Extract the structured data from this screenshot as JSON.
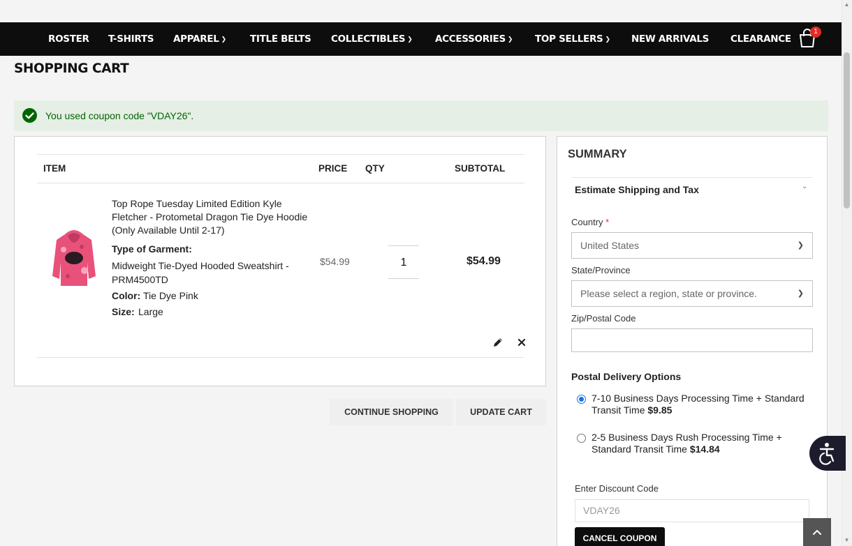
{
  "nav": {
    "items": [
      {
        "label": "ROSTER",
        "dropdown": false
      },
      {
        "label": "T-SHIRTS",
        "dropdown": false
      },
      {
        "label": "APPAREL",
        "dropdown": true
      },
      {
        "label": "TITLE BELTS",
        "dropdown": false
      },
      {
        "label": "COLLECTIBLES",
        "dropdown": true
      },
      {
        "label": "ACCESSORIES",
        "dropdown": true
      },
      {
        "label": "TOP SELLERS",
        "dropdown": true
      },
      {
        "label": "NEW ARRIVALS",
        "dropdown": false
      },
      {
        "label": "CLEARANCE",
        "dropdown": false
      }
    ],
    "cart_count": "1"
  },
  "page": {
    "title": "SHOPPING CART"
  },
  "message": {
    "text": "You used coupon code \"VDAY26\"."
  },
  "cart": {
    "headers": {
      "item": "ITEM",
      "price": "PRICE",
      "qty": "QTY",
      "subtotal": "SUBTOTAL"
    },
    "item": {
      "name": "Top Rope Tuesday Limited Edition Kyle Fletcher - Protometal Dragon Tie Dye Hoodie (Only Available Until 2-17)",
      "garment_label": "Type of Garment:",
      "garment_value": "Midweight Tie-Dyed Hooded Sweatshirt - PRM4500TD",
      "color_label": "Color:",
      "color_value": "Tie Dye Pink",
      "size_label": "Size:",
      "size_value": "Large",
      "price": "$54.99",
      "qty": "1",
      "subtotal": "$54.99"
    },
    "continue_label": "CONTINUE SHOPPING",
    "update_label": "UPDATE CART"
  },
  "summary": {
    "title": "SUMMARY",
    "estimate_title": "Estimate Shipping and Tax",
    "country_label": "Country",
    "country_required_mark": "*",
    "country_value": "United States",
    "state_label": "State/Province",
    "state_placeholder": "Please select a region, state or province.",
    "zip_label": "Zip/Postal Code",
    "zip_value": "",
    "delivery_title": "Postal Delivery Options",
    "options": [
      {
        "text": "7-10 Business Days Processing Time + Standard Transit Time",
        "price": "$9.85",
        "selected": true
      },
      {
        "text": "2-5 Business Days Rush Processing Time + Standard Transit Time",
        "price": "$14.84",
        "selected": false
      }
    ],
    "discount_label": "Enter Discount Code",
    "discount_value": "VDAY26",
    "cancel_coupon_label": "CANCEL COUPON"
  },
  "colors": {
    "nav_bg": "#0d0d0d",
    "success_bg": "#e5efe5",
    "success_text": "#006400",
    "badge": "#e02b27",
    "product_pink": "#e8527a"
  },
  "icons": [
    "chevron-down-icon",
    "shopping-bag-icon",
    "check-circle-icon",
    "pencil-icon",
    "close-icon",
    "accessibility-icon",
    "arrow-up-icon"
  ]
}
